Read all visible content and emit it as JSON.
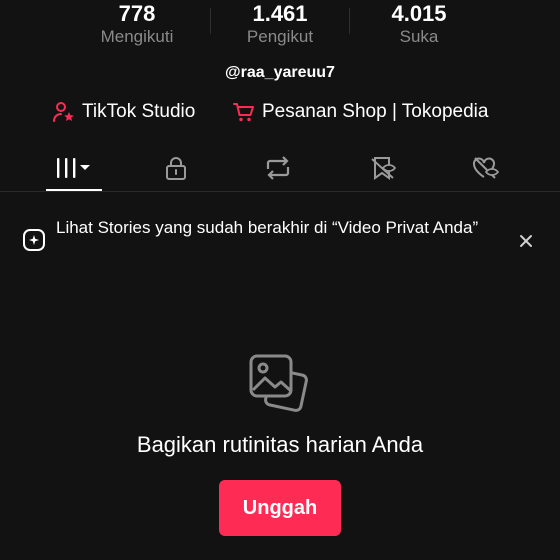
{
  "stats": [
    {
      "value": "778",
      "label": "Mengikuti"
    },
    {
      "value": "1.461",
      "label": "Pengikut"
    },
    {
      "value": "4.015",
      "label": "Suka"
    }
  ],
  "username": "@raa_yareuu7",
  "links": {
    "studio": {
      "label": "TikTok Studio",
      "icon": "user-star-icon"
    },
    "shop": {
      "label": "Pesanan Shop | Tokopedia",
      "icon": "shopping-cart-icon"
    }
  },
  "tabs": [
    {
      "icon": "grid-icon",
      "active": true
    },
    {
      "icon": "lock-icon",
      "active": false
    },
    {
      "icon": "repost-icon",
      "active": false
    },
    {
      "icon": "bookmark-icon",
      "active": false
    },
    {
      "icon": "heart-icon",
      "active": false
    }
  ],
  "notice": {
    "text": "Lihat Stories yang sudah berakhir di “Video Privat Anda”",
    "icon": "stories-icon",
    "close_icon": "close-icon"
  },
  "empty_state": {
    "icon": "photos-icon",
    "title": "Bagikan rutinitas harian Anda",
    "button_label": "Unggah"
  },
  "colors": {
    "background": "#121212",
    "accent": "#fe2c55",
    "muted_text": "#8a8a8a"
  }
}
